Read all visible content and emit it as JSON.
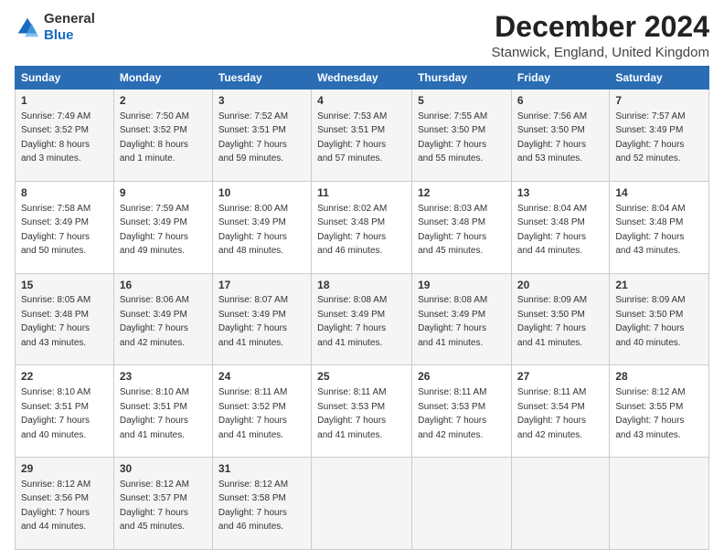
{
  "header": {
    "logo_line1": "General",
    "logo_line2": "Blue",
    "main_title": "December 2024",
    "subtitle": "Stanwick, England, United Kingdom"
  },
  "columns": [
    "Sunday",
    "Monday",
    "Tuesday",
    "Wednesday",
    "Thursday",
    "Friday",
    "Saturday"
  ],
  "weeks": [
    [
      {
        "day": "1",
        "info": "Sunrise: 7:49 AM\nSunset: 3:52 PM\nDaylight: 8 hours\nand 3 minutes."
      },
      {
        "day": "2",
        "info": "Sunrise: 7:50 AM\nSunset: 3:52 PM\nDaylight: 8 hours\nand 1 minute."
      },
      {
        "day": "3",
        "info": "Sunrise: 7:52 AM\nSunset: 3:51 PM\nDaylight: 7 hours\nand 59 minutes."
      },
      {
        "day": "4",
        "info": "Sunrise: 7:53 AM\nSunset: 3:51 PM\nDaylight: 7 hours\nand 57 minutes."
      },
      {
        "day": "5",
        "info": "Sunrise: 7:55 AM\nSunset: 3:50 PM\nDaylight: 7 hours\nand 55 minutes."
      },
      {
        "day": "6",
        "info": "Sunrise: 7:56 AM\nSunset: 3:50 PM\nDaylight: 7 hours\nand 53 minutes."
      },
      {
        "day": "7",
        "info": "Sunrise: 7:57 AM\nSunset: 3:49 PM\nDaylight: 7 hours\nand 52 minutes."
      }
    ],
    [
      {
        "day": "8",
        "info": "Sunrise: 7:58 AM\nSunset: 3:49 PM\nDaylight: 7 hours\nand 50 minutes."
      },
      {
        "day": "9",
        "info": "Sunrise: 7:59 AM\nSunset: 3:49 PM\nDaylight: 7 hours\nand 49 minutes."
      },
      {
        "day": "10",
        "info": "Sunrise: 8:00 AM\nSunset: 3:49 PM\nDaylight: 7 hours\nand 48 minutes."
      },
      {
        "day": "11",
        "info": "Sunrise: 8:02 AM\nSunset: 3:48 PM\nDaylight: 7 hours\nand 46 minutes."
      },
      {
        "day": "12",
        "info": "Sunrise: 8:03 AM\nSunset: 3:48 PM\nDaylight: 7 hours\nand 45 minutes."
      },
      {
        "day": "13",
        "info": "Sunrise: 8:04 AM\nSunset: 3:48 PM\nDaylight: 7 hours\nand 44 minutes."
      },
      {
        "day": "14",
        "info": "Sunrise: 8:04 AM\nSunset: 3:48 PM\nDaylight: 7 hours\nand 43 minutes."
      }
    ],
    [
      {
        "day": "15",
        "info": "Sunrise: 8:05 AM\nSunset: 3:48 PM\nDaylight: 7 hours\nand 43 minutes."
      },
      {
        "day": "16",
        "info": "Sunrise: 8:06 AM\nSunset: 3:49 PM\nDaylight: 7 hours\nand 42 minutes."
      },
      {
        "day": "17",
        "info": "Sunrise: 8:07 AM\nSunset: 3:49 PM\nDaylight: 7 hours\nand 41 minutes."
      },
      {
        "day": "18",
        "info": "Sunrise: 8:08 AM\nSunset: 3:49 PM\nDaylight: 7 hours\nand 41 minutes."
      },
      {
        "day": "19",
        "info": "Sunrise: 8:08 AM\nSunset: 3:49 PM\nDaylight: 7 hours\nand 41 minutes."
      },
      {
        "day": "20",
        "info": "Sunrise: 8:09 AM\nSunset: 3:50 PM\nDaylight: 7 hours\nand 41 minutes."
      },
      {
        "day": "21",
        "info": "Sunrise: 8:09 AM\nSunset: 3:50 PM\nDaylight: 7 hours\nand 40 minutes."
      }
    ],
    [
      {
        "day": "22",
        "info": "Sunrise: 8:10 AM\nSunset: 3:51 PM\nDaylight: 7 hours\nand 40 minutes."
      },
      {
        "day": "23",
        "info": "Sunrise: 8:10 AM\nSunset: 3:51 PM\nDaylight: 7 hours\nand 41 minutes."
      },
      {
        "day": "24",
        "info": "Sunrise: 8:11 AM\nSunset: 3:52 PM\nDaylight: 7 hours\nand 41 minutes."
      },
      {
        "day": "25",
        "info": "Sunrise: 8:11 AM\nSunset: 3:53 PM\nDaylight: 7 hours\nand 41 minutes."
      },
      {
        "day": "26",
        "info": "Sunrise: 8:11 AM\nSunset: 3:53 PM\nDaylight: 7 hours\nand 42 minutes."
      },
      {
        "day": "27",
        "info": "Sunrise: 8:11 AM\nSunset: 3:54 PM\nDaylight: 7 hours\nand 42 minutes."
      },
      {
        "day": "28",
        "info": "Sunrise: 8:12 AM\nSunset: 3:55 PM\nDaylight: 7 hours\nand 43 minutes."
      }
    ],
    [
      {
        "day": "29",
        "info": "Sunrise: 8:12 AM\nSunset: 3:56 PM\nDaylight: 7 hours\nand 44 minutes."
      },
      {
        "day": "30",
        "info": "Sunrise: 8:12 AM\nSunset: 3:57 PM\nDaylight: 7 hours\nand 45 minutes."
      },
      {
        "day": "31",
        "info": "Sunrise: 8:12 AM\nSunset: 3:58 PM\nDaylight: 7 hours\nand 46 minutes."
      },
      null,
      null,
      null,
      null
    ]
  ]
}
